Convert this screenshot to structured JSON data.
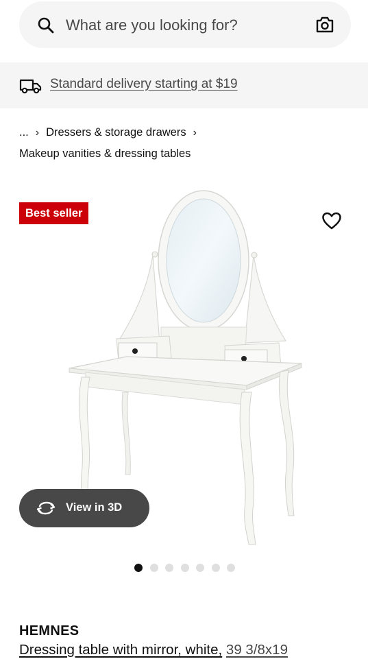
{
  "search": {
    "placeholder": "What are you looking for?"
  },
  "delivery": {
    "text": "Standard delivery starting at $19"
  },
  "breadcrumb": {
    "items": [
      "...",
      "Dressers & storage drawers",
      "Makeup vanities & dressing tables"
    ],
    "separator": "›"
  },
  "badge": {
    "label": "Best seller",
    "color": "#cc0008"
  },
  "view3d": {
    "label": "View in 3D"
  },
  "carousel": {
    "total": 7,
    "active_index": 0
  },
  "product": {
    "brand": "HEMNES",
    "description": "Dressing table with mirror, white,",
    "dimensions": "39 3/8x19"
  },
  "icons": [
    "search-icon",
    "camera-icon",
    "truck-icon",
    "heart-icon",
    "rotate-3d-icon"
  ]
}
